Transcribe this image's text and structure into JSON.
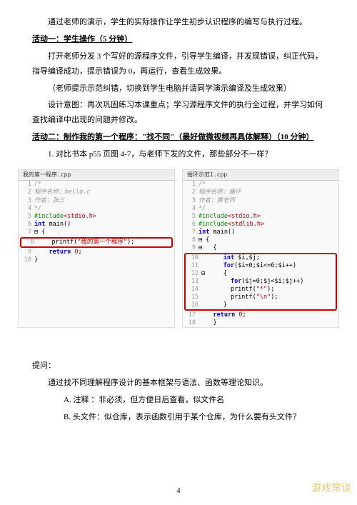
{
  "intro": "通过老师的演示，学生的实际操作让学生初步认识程序的编写与执行过程。",
  "act1_title": "活动一：学生操作（5 分钟）",
  "act1_p1": "打开老师分发 3 个写好的源程序文件，引导学生编译，并发现错误，纠正代码，指导编译成功，提示错误为 0，再运行，查看生成效果。",
  "act1_p2": "（老师提示示范纠错，切换到学生电脑并请同学演示编译及生成效果）",
  "act1_p3": "设计意图：再次巩固练习本课重点；学习源程序文件的执行全过程，并学习如何查找编译中出现的问题并修改。",
  "act2_title": "活动二：制作我的第一个程序：\"找不同\"（最好做微视频再具体解释）（10 分钟）",
  "act2_q1": "1.  对比书本 p55 页图 4-7，与老师下发的文件，那些部分不一样？",
  "code1": {
    "tab": "我的第一程序.cpp",
    "l1": "/*",
    "l2": "程序名称：hello.c",
    "l3": "作者：张三",
    "l4": "*/",
    "l5_inc": "#include",
    "l5_hdr": "<stdio.h>",
    "l6_kw": "int",
    "l6_fn": " main()",
    "l7": "{",
    "l8_fn": "printf(",
    "l8_str": "\"我的第一个程序\"",
    "l8_end": ");",
    "l9_kw": "return ",
    "l9_num": "0",
    "l9_end": ";",
    "l10": "}"
  },
  "code2": {
    "tab": "循环示范1.cpp",
    "l1": "/*",
    "l2": "程序名称：循环",
    "l3": "作者：黄老师",
    "l4": "*/",
    "l5_inc": "#include",
    "l5_hdr": "<stdio.h>",
    "l6_inc": "#include",
    "l6_hdr": "<stdlib.h>",
    "l7_kw": "int",
    "l7_fn": " main()",
    "l8": "{",
    "l9": "{",
    "l10_kw": "int ",
    "l10_rest": "$i,$j;",
    "l11_kw": "for",
    "l11_rest": "($i=0;$i<=6;$i++)",
    "l12": "{",
    "l13_kw": "for",
    "l13_rest": "($j=0;$j<$i;$j++)",
    "l14_fn": "printf(",
    "l14_str": "\"*\"",
    "l14_end": ");",
    "l15_fn": "printf(",
    "l15_str": "\"\\n\"",
    "l15_end": ");",
    "l16": "}",
    "l17_kw": "return ",
    "l17_num": "0",
    "l17_end": ";",
    "l18": "}"
  },
  "q_title": "提问：",
  "q_p1": "通过找不同理解程序设计的基本框架与语法、函数等理论知识。",
  "q_a": "A. 注释 ：非必须，但方便日后查看，似文件名",
  "q_b": "B. 头文件：似仓库，表示函数引用于某个仓库，为什么要有头文件？",
  "page_num": "4",
  "watermark": "游戏常谈"
}
